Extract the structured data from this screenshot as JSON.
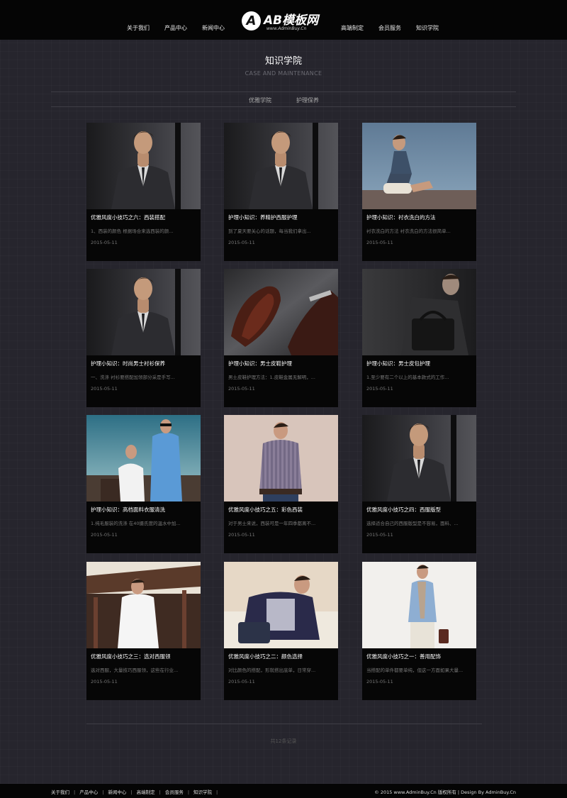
{
  "header": {
    "nav_left": [
      "关于我们",
      "产品中心",
      "新闻中心"
    ],
    "nav_right": [
      "高端制定",
      "会员服务",
      "知识学院"
    ],
    "logo_mark": "A",
    "logo_title": "AB模板网",
    "logo_sub": "www.AdminBuy.Cn"
  },
  "page": {
    "title": "知识学院",
    "subtitle": "CASE AND MAINTENANCE"
  },
  "subnav": [
    "优雅学院",
    "护理保养"
  ],
  "articles": [
    {
      "title": "优雅风度小技巧之六：西装搭配",
      "excerpt": "1、西装的颜色 根据场合来选西装的颜...",
      "date": "2015-05-11",
      "image": "man-in-gray-suit-photo"
    },
    {
      "title": "护理小知识：养精护西服护理",
      "excerpt": "到了夏天要关心的话题，每当我们拿出...",
      "date": "2015-05-11",
      "image": "man-in-gray-suit-photo"
    },
    {
      "title": "护理小知识：衬衣洗白的方法",
      "excerpt": "衬衣洗白的方法 衬衣洗白的方法很简单...",
      "date": "2015-05-11",
      "image": "man-by-sea-photo"
    },
    {
      "title": "护理小知识：时尚男士衬衫保养",
      "excerpt": "一、洗涤 衬衫要搭配加领部分采是手写...",
      "date": "2015-05-11",
      "image": "man-in-gray-suit-photo"
    },
    {
      "title": "护理小知识：男士皮鞋护理",
      "excerpt": "男士皮鞋护理方法：1.皮鞋金属无解明，...",
      "date": "2015-05-11",
      "image": "leather-shoes-photo"
    },
    {
      "title": "护理小知识：男士皮包护理",
      "excerpt": "1.至少要有二个以上的基本款式的工作...",
      "date": "2015-05-11",
      "image": "man-with-leather-bag-photo"
    },
    {
      "title": "护理小知识：高档面料衣服清洗",
      "excerpt": "1.纯毛服装的洗涤 在40摄氏度的温水中加...",
      "date": "2015-05-11",
      "image": "men-in-white-and-blue-suits-photo"
    },
    {
      "title": "优雅风度小技巧之五：彩色西装",
      "excerpt": "对于男士来说，西装可是一年四季都离不...",
      "date": "2015-05-11",
      "image": "man-in-checked-shirt-photo"
    },
    {
      "title": "优雅风度小技巧之四：西服版型",
      "excerpt": "选择适合自己的西服版型是不容易，面料、...",
      "date": "2015-05-11",
      "image": "man-in-gray-suit-photo"
    },
    {
      "title": "优雅风度小技巧之三：选对西服领",
      "excerpt": "选对西服，大量技巧西服领，这些在行业...",
      "date": "2015-05-11",
      "image": "man-in-white-suit-temple-photo"
    },
    {
      "title": "优雅风度小技巧之二：颜色选择",
      "excerpt": "对比颜色的搭配，形就搭出底单，日常穿...",
      "date": "2015-05-11",
      "image": "man-on-sofa-photo"
    },
    {
      "title": "优雅风度小技巧之一：善用配饰",
      "excerpt": "当搭配的单件都要单纯，但这一方面如果大量...",
      "date": "2015-05-11",
      "image": "man-with-scarf-photo"
    }
  ],
  "footer": {
    "center_text": "共12条记录",
    "links": [
      "关于我们",
      "产品中心",
      "新闻中心",
      "高端制定",
      "会员服务",
      "知识学院"
    ],
    "copyright": "© 2015 www.AdminBuy.Cn 版权所有 | Design By AdminBuy.Cn"
  }
}
